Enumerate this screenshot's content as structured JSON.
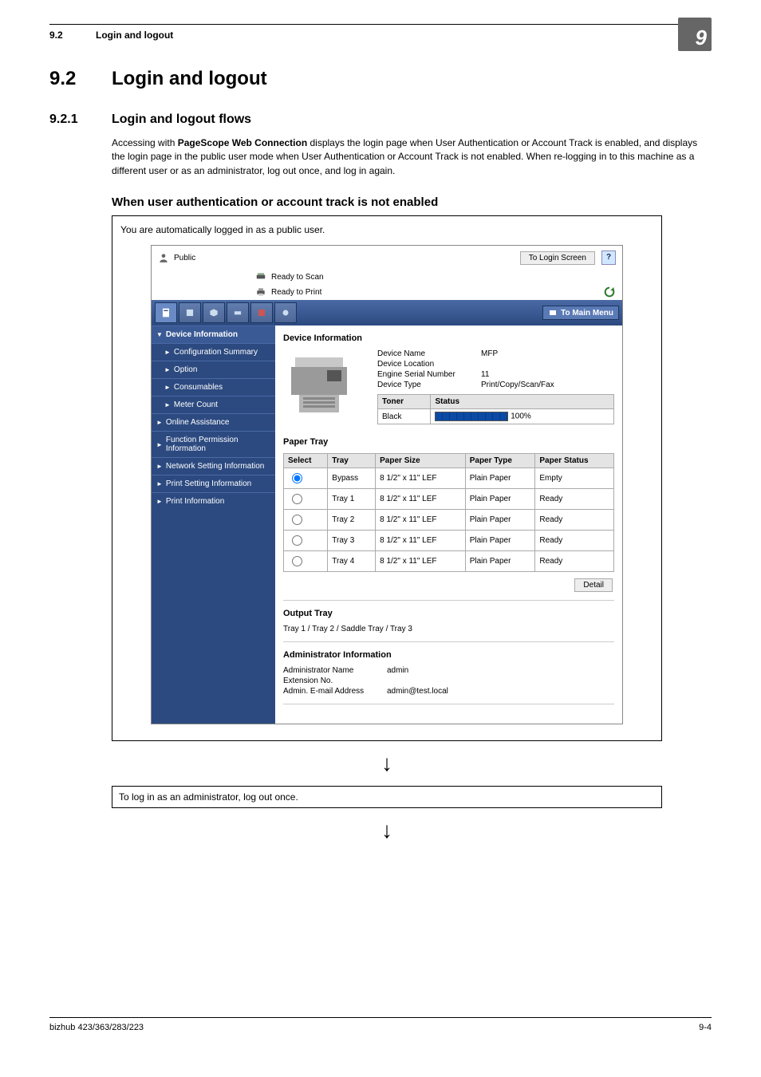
{
  "running": {
    "secnum": "9.2",
    "title": "Login and logout"
  },
  "chapter": "9",
  "h2": {
    "num": "9.2",
    "title": "Login and logout"
  },
  "h3": {
    "num": "9.2.1",
    "title": "Login and logout flows"
  },
  "para": {
    "p1a": "Accessing with ",
    "bold": "PageScope Web Connection",
    "p1b": " displays the login page when User Authentication or Account Track is enabled, and displays the login page in the public user mode when User Authentication or Account Track is not enabled. When re-logging in to this machine as a different user or as an administrator, log out once, and log in again."
  },
  "h4": "When user authentication or account track is not enabled",
  "box_intro": "You are automatically logged in as a public user.",
  "ss": {
    "user_mode": "Public",
    "to_login": "To Login Screen",
    "help": "?",
    "status_scan": "Ready to Scan",
    "status_print": "Ready to Print",
    "to_main": "To Main Menu",
    "sidebar": [
      "Device Information",
      "Configuration Summary",
      "Option",
      "Consumables",
      "Meter Count",
      "Online Assistance",
      "Function Permission Information",
      "Network Setting Information",
      "Print Setting Information",
      "Print Information"
    ],
    "dev_title": "Device Information",
    "kv": {
      "name_k": "Device Name",
      "name_v": "MFP",
      "loc_k": "Device Location",
      "loc_v": "",
      "serial_k": "Engine Serial Number",
      "serial_v": "11",
      "type_k": "Device Type",
      "type_v": "Print/Copy/Scan/Fax"
    },
    "toner": {
      "h1": "Toner",
      "h2": "Status",
      "row_label": "Black",
      "pct": "100%"
    },
    "paper_title": "Paper Tray",
    "paper_headers": [
      "Select",
      "Tray",
      "Paper Size",
      "Paper Type",
      "Paper Status"
    ],
    "paper_rows": [
      {
        "tray": "Bypass",
        "size": "8 1/2\" x 11\" LEF",
        "type": "Plain Paper",
        "status": "Empty",
        "selected": true
      },
      {
        "tray": "Tray 1",
        "size": "8 1/2\" x 11\" LEF",
        "type": "Plain Paper",
        "status": "Ready",
        "selected": false
      },
      {
        "tray": "Tray 2",
        "size": "8 1/2\" x 11\" LEF",
        "type": "Plain Paper",
        "status": "Ready",
        "selected": false
      },
      {
        "tray": "Tray 3",
        "size": "8 1/2\" x 11\" LEF",
        "type": "Plain Paper",
        "status": "Ready",
        "selected": false
      },
      {
        "tray": "Tray 4",
        "size": "8 1/2\" x 11\" LEF",
        "type": "Plain Paper",
        "status": "Ready",
        "selected": false
      }
    ],
    "detail_btn": "Detail",
    "output_title": "Output Tray",
    "output_text": "Tray 1 / Tray 2 / Saddle Tray / Tray 3",
    "admin_title": "Administrator Information",
    "admin": {
      "name_k": "Administrator Name",
      "name_v": "admin",
      "ext_k": "Extension No.",
      "ext_v": "",
      "email_k": "Admin. E-mail Address",
      "email_v": "admin@test.local"
    }
  },
  "note": "To log in as an administrator, log out once.",
  "footer": {
    "left": "bizhub 423/363/283/223",
    "right": "9-4"
  }
}
